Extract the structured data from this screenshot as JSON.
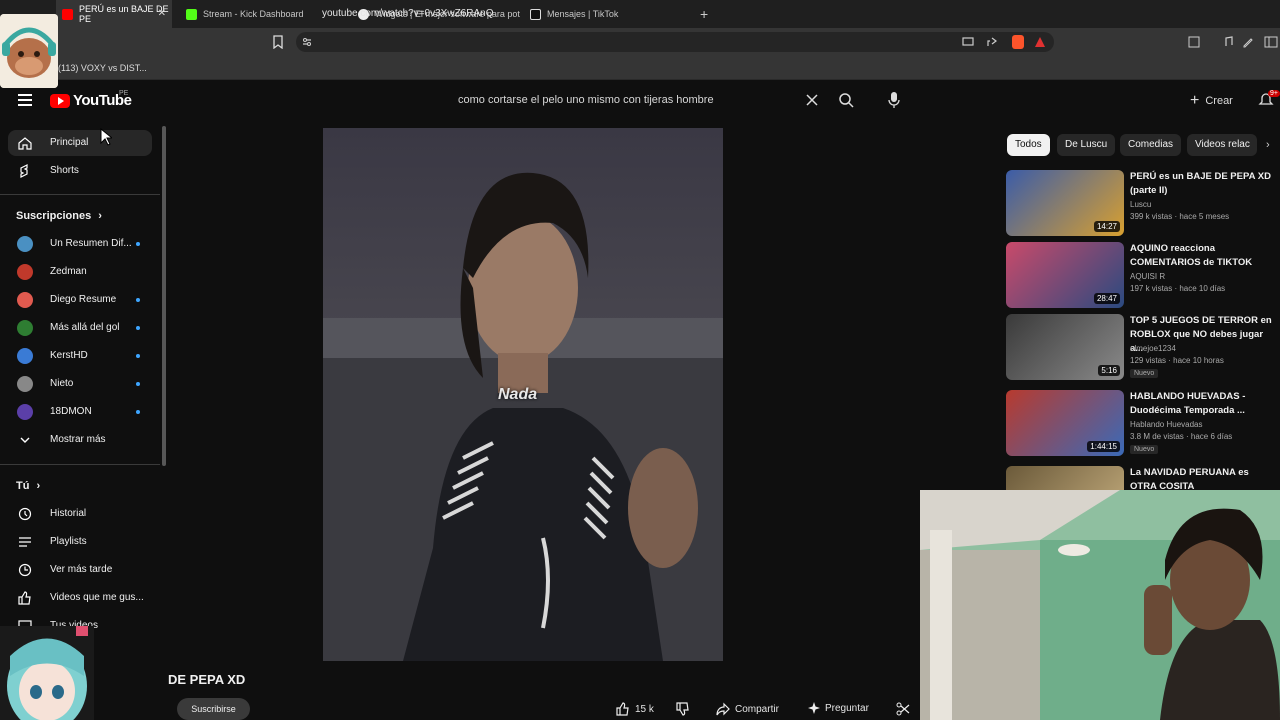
{
  "browser": {
    "tabs": [
      {
        "label": "PERÚ es un BAJE DE PE",
        "active": true,
        "icon": "youtube-icon",
        "color": "#ff0000"
      },
      {
        "label": "Stream - Kick Dashboard",
        "active": false,
        "icon": "kick-icon",
        "color": "#53fc18"
      },
      {
        "label": "Widgets | El mejor software para pot",
        "active": false,
        "icon": "widgets-icon",
        "color": "#ffffff"
      },
      {
        "label": "Mensajes | TikTok",
        "active": false,
        "icon": "tiktok-icon",
        "color": "#ffffff"
      }
    ],
    "new_tab": "+",
    "url": "youtube.com/watch?v=0v3XwZ6RAnQ",
    "bookmark": "(113) VOXY vs DIST..."
  },
  "header": {
    "logo_text": "YouTube",
    "region": "PE",
    "search_query": "como cortarse el pelo uno mismo con tijeras hombre",
    "create_label": "Crear",
    "notification_count": "9+"
  },
  "sidebar": {
    "main": [
      {
        "label": "Principal",
        "icon": "home-icon",
        "active": true
      },
      {
        "label": "Shorts",
        "icon": "shorts-icon",
        "active": false
      }
    ],
    "subscriptions_heading": "Suscripciones",
    "subscriptions": [
      {
        "label": "Un Resumen Dif...",
        "color": "#4a90c2",
        "dot": true
      },
      {
        "label": "Zedman",
        "color": "#c0392b",
        "dot": false
      },
      {
        "label": "Diego Resume",
        "color": "#e05a4f",
        "dot": true
      },
      {
        "label": "Más allá del gol",
        "color": "#2e7d32",
        "dot": true
      },
      {
        "label": "KerstHD",
        "color": "#3a7bd5",
        "dot": true
      },
      {
        "label": "Nieto",
        "color": "#888888",
        "dot": true
      },
      {
        "label": "18DMON",
        "color": "#5b3fa8",
        "dot": true
      }
    ],
    "show_more": "Mostrar más",
    "you_heading": "Tú",
    "you_items": [
      {
        "label": "Historial",
        "icon": "history-icon"
      },
      {
        "label": "Playlists",
        "icon": "playlists-icon"
      },
      {
        "label": "Ver más tarde",
        "icon": "clock-icon"
      },
      {
        "label": "Videos que me gus...",
        "icon": "thumbs-up-icon"
      },
      {
        "label": "Tus videos",
        "icon": "video-icon"
      }
    ]
  },
  "video": {
    "caption": "Nada",
    "title_partial": "DE PEPA XD",
    "subscribe": "Suscribirse",
    "likes": "15 k",
    "share": "Compartir",
    "ask": "Preguntar"
  },
  "chips": [
    "Todos",
    "De Luscu",
    "Comedias",
    "Videos relac"
  ],
  "recommendations": [
    {
      "title": "PERÚ es un BAJE DE PEPA XD (parte II)",
      "channel": "Luscu",
      "meta": "399 k vistas · hace 5 meses",
      "duration": "14:27",
      "badge": "",
      "thumb": "#3b5ca8"
    },
    {
      "title": "AQUINO reacciona COMENTARIOS de TIKTOK",
      "channel": "AQUISI R",
      "meta": "197 k vistas · hace 10 días",
      "duration": "28:47",
      "badge": "",
      "thumb": "#c94a6a"
    },
    {
      "title": "TOP 5 JUEGOS DE TERROR en ROBLOX que NO debes jugar a...",
      "channel": "elmejoe1234",
      "meta": "129 vistas · hace 10 horas",
      "duration": "5:16",
      "badge": "Nuevo",
      "thumb": "#5a5a5a"
    },
    {
      "title": "HABLANDO HUEVADAS - Duodécima Temporada ...",
      "channel": "Hablando Huevadas",
      "meta": "3.8 M de vistas · hace 6 días",
      "duration": "1:44:15",
      "badge": "Nuevo",
      "thumb": "#b83a2e"
    },
    {
      "title": "La NAVIDAD PERUANA es OTRA COSITA",
      "channel": "",
      "meta": "",
      "duration": "",
      "badge": "",
      "thumb": "#6b5a3a"
    }
  ]
}
